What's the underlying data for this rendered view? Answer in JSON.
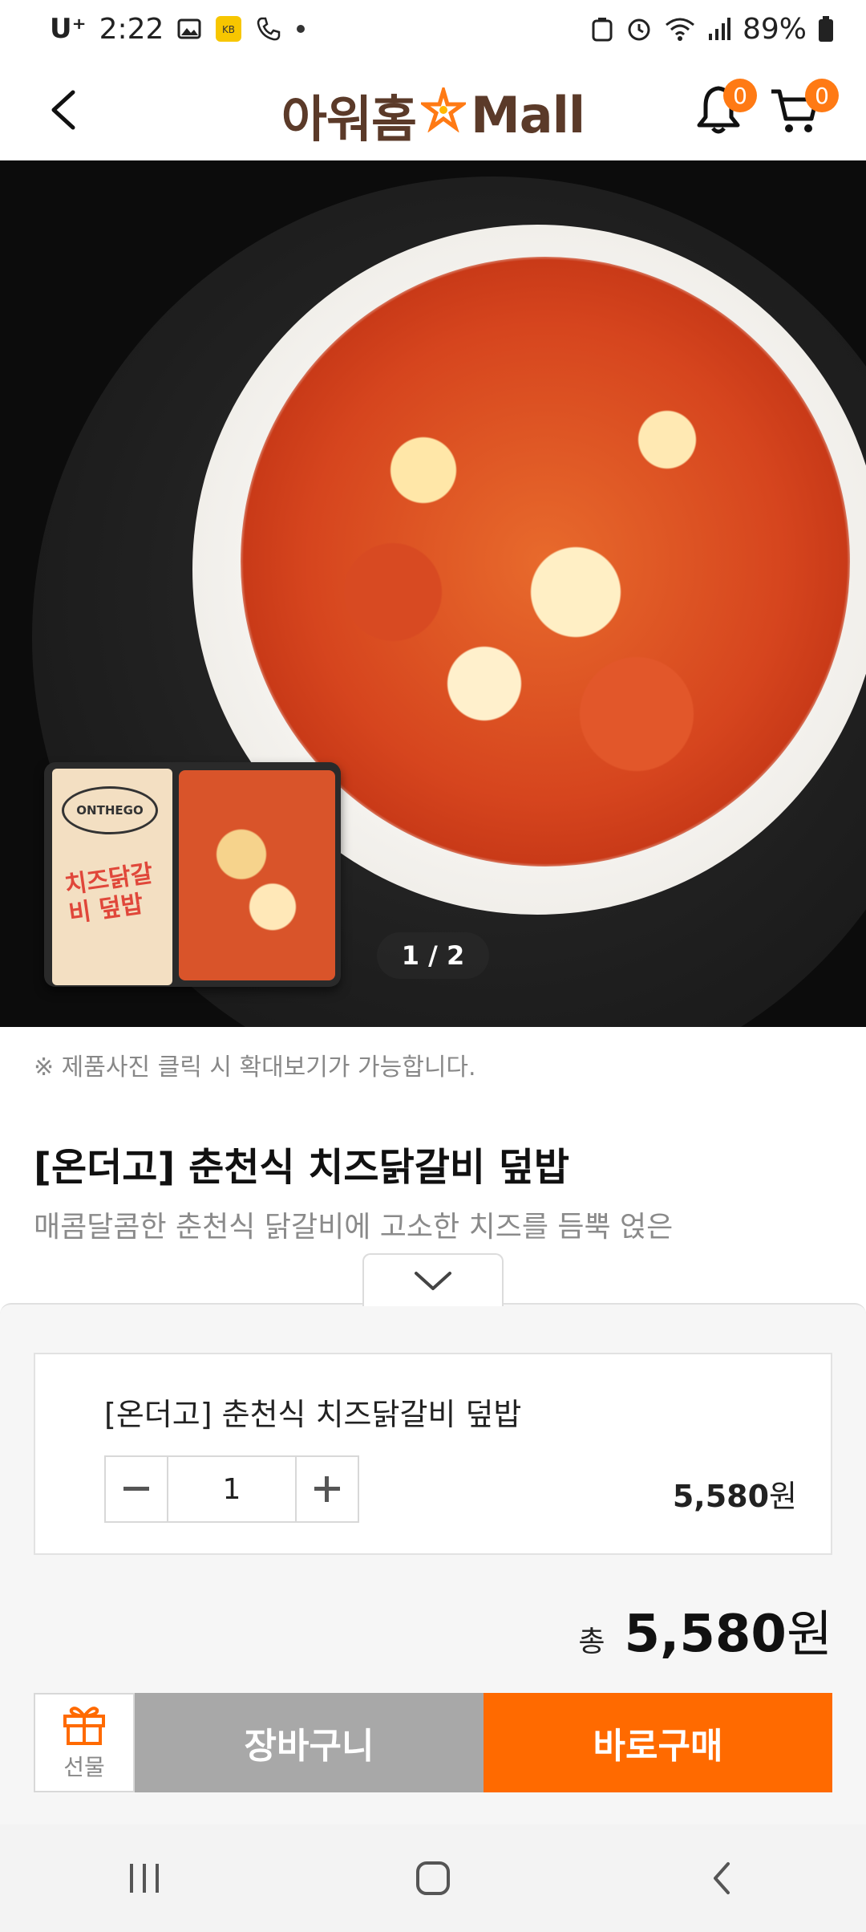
{
  "status_bar": {
    "carrier": "U⁺",
    "time": "2:22",
    "battery": "89%"
  },
  "header": {
    "logo_korean": "아워홈",
    "logo_mall": "Mall",
    "notification_count": "0",
    "cart_count": "0"
  },
  "gallery": {
    "pager": "1 / 2",
    "package_brand": "ONTHEGO",
    "package_title": "치즈닭갈비 덮밥"
  },
  "product": {
    "zoom_note": "※ 제품사진 클릭 시 확대보기가 가능합니다.",
    "title": "[온더고] 춘천식 치즈닭갈비 덮밥",
    "description": "매콤달콤한 춘천식 닭갈비에 고소한 치즈를 듬뿍 얹은"
  },
  "order_sheet": {
    "option_name": "[온더고] 춘천식 치즈닭갈비 덮밥",
    "quantity": "1",
    "option_price": "5,580",
    "option_unit": "원",
    "total_label": "총",
    "total_price": "5,580",
    "total_unit": "원",
    "gift_label": "선물",
    "cart_label": "장바구니",
    "buy_label": "바로구매"
  },
  "colors": {
    "accent": "#ff6a00",
    "badge": "#ff7a14",
    "cart_button": "#a8a8a8",
    "logo_brown": "#5b3a29"
  }
}
